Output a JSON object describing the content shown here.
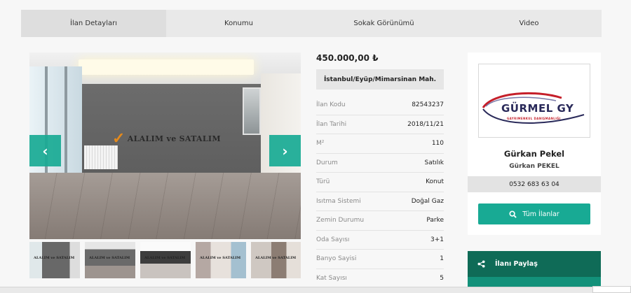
{
  "tabs": [
    {
      "label": "İlan Detayları"
    },
    {
      "label": "Konumu"
    },
    {
      "label": "Sokak Görünümü"
    },
    {
      "label": "Video"
    }
  ],
  "gallery": {
    "watermark": "ALALIM ve SATALIM",
    "thumb_watermark": "ALALIM ve SATALIM",
    "prev_icon": "chevron-left-icon",
    "next_icon": "chevron-right-icon"
  },
  "listing": {
    "price": "450.000,00 ₺",
    "location": "İstanbul/Eyüp/Mimarsinan Mah.",
    "details": [
      {
        "key": "İlan Kodu",
        "value": "82543237"
      },
      {
        "key": "İlan Tarihi",
        "value": "2018/11/21"
      },
      {
        "key": "M²",
        "value": "110"
      },
      {
        "key": "Durum",
        "value": "Satılık"
      },
      {
        "key": "Türü",
        "value": "Konut"
      },
      {
        "key": "Isıtma Sistemi",
        "value": "Doğal Gaz"
      },
      {
        "key": "Zemin Durumu",
        "value": "Parke"
      },
      {
        "key": "Oda Sayısı",
        "value": "3+1"
      },
      {
        "key": "Banyo Sayisi",
        "value": "1"
      },
      {
        "key": "Kat Sayısı",
        "value": "5"
      }
    ]
  },
  "agent": {
    "logo_text": "GÜRMEL GY",
    "logo_subtext": "GAYRIMENKUL DANIŞMANLIĞI",
    "name": "Gürkan Pekel",
    "company": "Gürkan PEKEL",
    "phone": "0532 683 63 04",
    "all_listings_label": "Tüm İlanlar",
    "share_label": "İlanı Paylaş"
  },
  "colors": {
    "accent": "#18aa94",
    "share_bg": "#0f6b57",
    "logo_red": "#c51f2a",
    "logo_navy": "#2a2a5a"
  }
}
